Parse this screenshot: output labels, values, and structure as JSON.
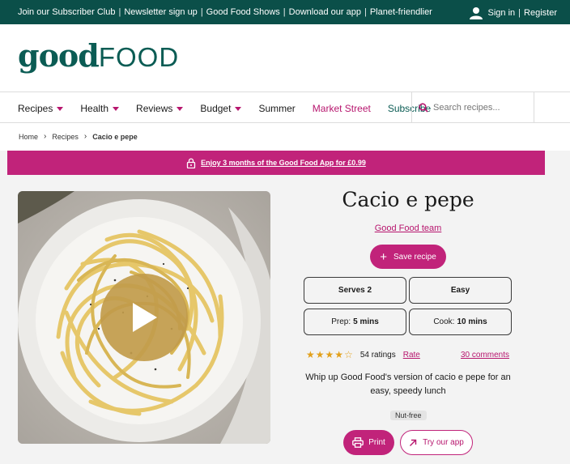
{
  "topbar": {
    "links": [
      "Join our Subscriber Club",
      "Newsletter sign up",
      "Good Food Shows",
      "Download our app",
      "Planet-friendlier"
    ],
    "separator": "|",
    "sign_in": "Sign in",
    "register": "Register"
  },
  "logo": {
    "good": "good",
    "food": "FOOD"
  },
  "nav": {
    "recipes": "Recipes",
    "health": "Health",
    "reviews": "Reviews",
    "budget": "Budget",
    "summer": "Summer",
    "market_street": "Market Street",
    "subscribe": "Subscribe"
  },
  "search": {
    "placeholder": "Search recipes..."
  },
  "breadcrumb": {
    "home": "Home",
    "recipes": "Recipes",
    "current": "Cacio e pepe",
    "chevron": "›"
  },
  "promo": {
    "text": "Enjoy 3 months of the Good Food App for £0.99"
  },
  "recipe": {
    "title": "Cacio e pepe",
    "author": "Good Food team",
    "save_label": "Save recipe",
    "save_plus": "+",
    "serves_label": "Serves 2",
    "difficulty": "Easy",
    "prep_label": "Prep:",
    "prep_value": "5 mins",
    "cook_label": "Cook:",
    "cook_value": "10 mins",
    "rating_stars": 4,
    "rating_max": 5,
    "ratings_count": "54 ratings",
    "rate_label": "Rate",
    "comments": "30 comments",
    "description": "Whip up Good Food's version of cacio e pepe for an easy, speedy lunch",
    "badge": "Nut-free",
    "print_label": "Print",
    "app_label": "Try our app"
  },
  "colors": {
    "brand_teal": "#0b4f49",
    "logo_teal": "#0b5c54",
    "accent_magenta": "#c1237a",
    "star_gold": "#e2a01a"
  },
  "icons": [
    "user-icon",
    "search-icon",
    "lock-icon",
    "play-icon",
    "plus-icon",
    "star-icon",
    "printer-icon",
    "external-arrow-icon"
  ]
}
